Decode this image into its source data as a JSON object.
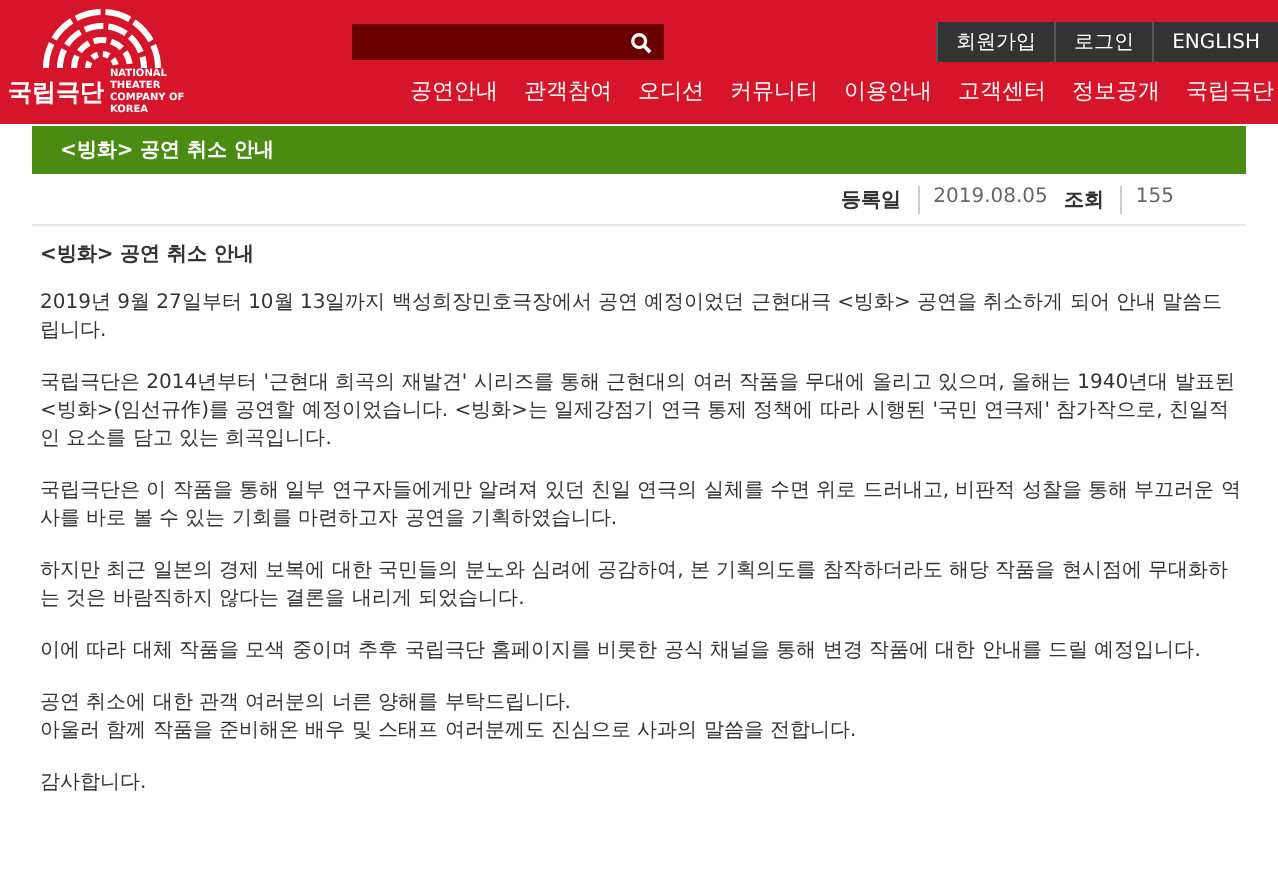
{
  "header": {
    "logo_text": "국립극단",
    "logo_subtitle": "NATIONAL THEATER COMPANY OF KOREA",
    "top_buttons": [
      "회원가입",
      "로그인",
      "ENGLISH"
    ],
    "nav": [
      "공연안내",
      "관객참여",
      "오디션",
      "커뮤니티",
      "이용안내",
      "고객센터",
      "정보공개",
      "국립극단"
    ]
  },
  "banner": {
    "title": "<빙화> 공연 취소 안내"
  },
  "meta": [
    {
      "label": "등록일",
      "value": "2019.08.05"
    },
    {
      "label": "조회",
      "value": "155"
    }
  ],
  "article": {
    "title": "<빙화> 공연 취소 안내",
    "paragraphs": [
      [
        "2019년 9월 27일부터 10월 13일까지 백성희장민호극장에서 공연 예정이었던 근현대극 <빙화> 공연을 취소하게 되어 안내 말씀드립니다."
      ],
      [
        "국립극단은 2014년부터 '근현대 희곡의 재발견' 시리즈를 통해 근현대의 여러 작품을 무대에 올리고 있으며, 올해는 1940년대 발표된 <빙화>(임선규作)를 공연할 예정이었습니다. <빙화>는 일제강점기 연극 통제 정책에 따라 시행된 '국민 연극제' 참가작으로, 친일적인 요소를 담고 있는 희곡입니다."
      ],
      [
        "국립극단은 이 작품을 통해 일부 연구자들에게만 알려져 있던 친일 연극의 실체를 수면 위로 드러내고, 비판적 성찰을 통해 부끄러운 역사를 바로 볼 수 있는 기회를 마련하고자 공연을 기획하였습니다."
      ],
      [
        "하지만 최근 일본의 경제 보복에 대한 국민들의 분노와 심려에 공감하여, 본 기획의도를 참작하더라도 해당 작품을 현시점에 무대화하는 것은 바람직하지 않다는 결론을 내리게 되었습니다."
      ],
      [
        "이에 따라 대체 작품을 모색 중이며 추후 국립극단 홈페이지를 비롯한 공식 채널을 통해 변경 작품에 대한 안내를 드릴 예정입니다."
      ],
      [
        "공연 취소에 대한 관객 여러분의 너른 양해를 부탁드립니다.",
        "아울러 함께 작품을 준비해온 배우 및 스태프 여러분께도 진심으로 사과의 말씀을 전합니다."
      ],
      [
        "감사합니다."
      ]
    ]
  }
}
